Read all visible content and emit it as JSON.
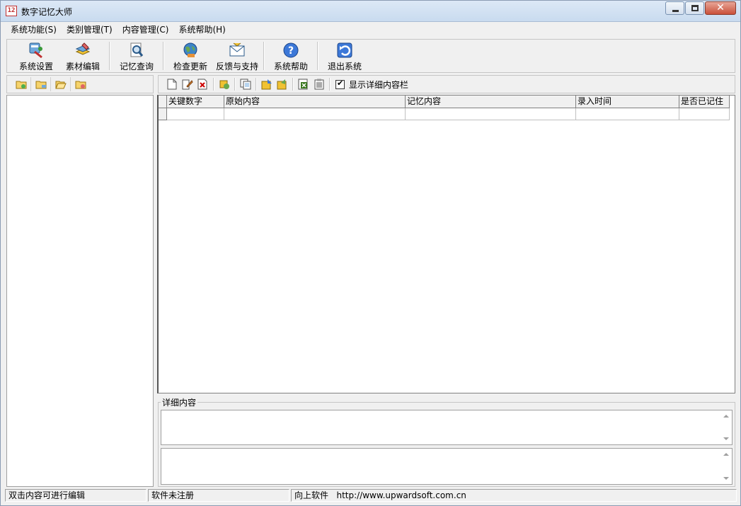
{
  "window": {
    "title": "数字记忆大师",
    "icon_text": "12"
  },
  "menu": [
    {
      "label": "系统功能(S)"
    },
    {
      "label": "类别管理(T)"
    },
    {
      "label": "内容管理(C)"
    },
    {
      "label": "系统帮助(H)"
    }
  ],
  "toolbar": {
    "settings": "系统设置",
    "material_edit": "素材编辑",
    "memory_query": "记忆查询",
    "check_update": "检查更新",
    "feedback": "反馈与支持",
    "help": "系统帮助",
    "exit": "退出系统"
  },
  "right_toolbar": {
    "show_detail_label": "显示详细内容栏",
    "show_detail_checked": true
  },
  "grid": {
    "columns": [
      "关键数字",
      "原始内容",
      "记忆内容",
      "录入时间",
      "是否已记住"
    ]
  },
  "detail": {
    "legend": "详细内容"
  },
  "status": {
    "hint": "双击内容可进行编辑",
    "registration": "软件未注册",
    "company": "向上软件",
    "url": "http://www.upwardsoft.com.cn"
  },
  "colors": {
    "title_bar": "#dce8f6",
    "close_button": "#c9513a",
    "background": "#f0f0f0"
  }
}
